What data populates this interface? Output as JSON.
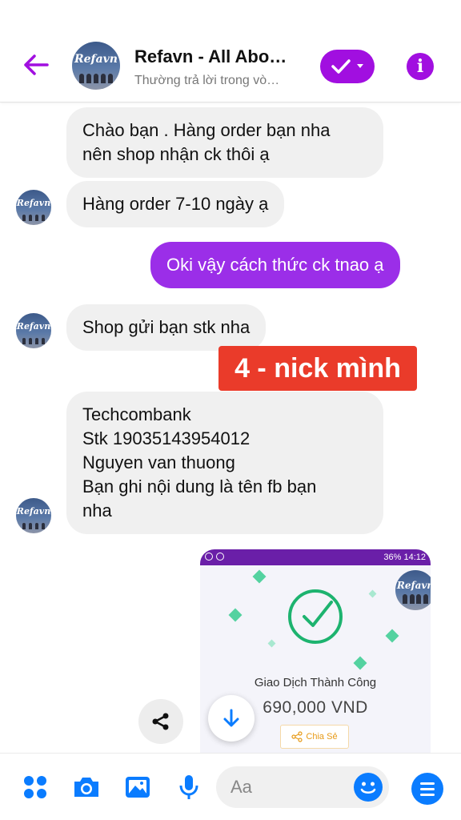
{
  "header": {
    "title": "Refavn - All Abo…",
    "subtitle": "Thường trả lời trong vò…",
    "avatar_text": "Refavn"
  },
  "messages": [
    {
      "from": "them",
      "lines": [
        "Chào bạn . Hàng order bạn nha",
        "nên shop nhận ck thôi ạ"
      ]
    },
    {
      "from": "them",
      "lines": [
        "Hàng order 7-10 ngày ạ"
      ]
    },
    {
      "from": "me",
      "lines": [
        "Oki vậy cách thức ck tnao ạ"
      ]
    },
    {
      "from": "them",
      "lines": [
        "Shop gửi bạn stk nha"
      ]
    },
    {
      "from": "them",
      "lines": [
        "Techcombank",
        "Stk 19035143954012",
        "Nguyen van thuong",
        "Bạn ghi nội dung là tên fb bạn",
        "nha"
      ]
    }
  ],
  "annotation": "4 - nick mình",
  "image_message": {
    "status_time": "36% 14:12",
    "title": "Giao Dịch Thành Công",
    "amount": "690,000 VND",
    "share_label": "Chia Sẻ",
    "avatar_text": "Refavn"
  },
  "composer": {
    "placeholder": "Aa"
  },
  "colors": {
    "accent": "#a10fe0",
    "my_bubble": "#9b2ee8",
    "their_bubble": "#f0f0f0",
    "messenger_blue": "#0a7cff",
    "annotation": "#ea3b2a",
    "success_green": "#1db36f"
  },
  "icons": [
    "back-arrow-icon",
    "check-icon",
    "chevron-down-icon",
    "info-icon",
    "share-icon",
    "arrow-down-icon",
    "apps-icon",
    "camera-icon",
    "image-icon",
    "microphone-icon",
    "emoji-icon",
    "menu-icon"
  ]
}
